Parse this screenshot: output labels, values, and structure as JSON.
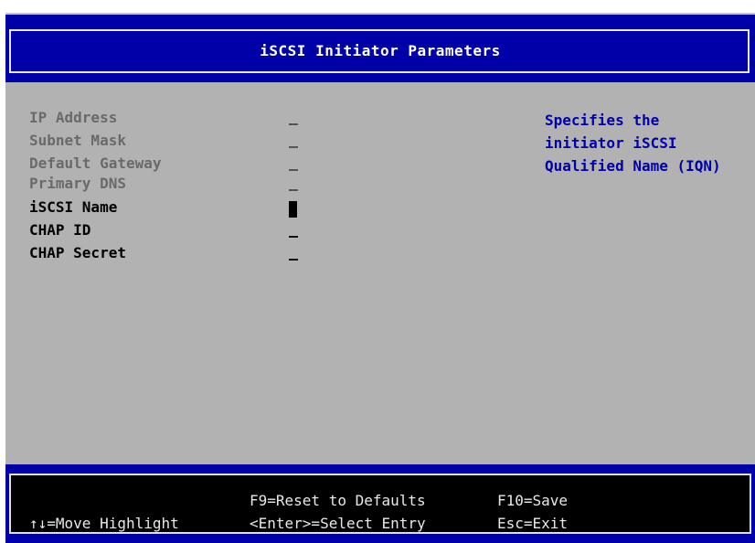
{
  "title": "iSCSI Initiator Parameters",
  "fields": [
    {
      "label": "IP Address",
      "value": "_",
      "enabled": false
    },
    {
      "label": "Subnet Mask",
      "value": "_",
      "enabled": false
    },
    {
      "label": "Default Gateway",
      "value": "_",
      "enabled": false
    },
    {
      "label": "Primary DNS",
      "value": "_",
      "enabled": false
    },
    {
      "label": "iSCSI Name",
      "value": "",
      "enabled": true,
      "selected": true
    },
    {
      "label": "CHAP ID",
      "value": "_",
      "enabled": true
    },
    {
      "label": "CHAP Secret",
      "value": "_",
      "enabled": true
    }
  ],
  "help": {
    "line1": "Specifies the",
    "line2": "initiator iSCSI",
    "line3": "Qualified Name (IQN)"
  },
  "footer": {
    "move": "↑↓=Move Highlight",
    "reset": "F9=Reset to Defaults",
    "select": "<Enter>=Select Entry",
    "save": "F10=Save",
    "exit": "Esc=Exit"
  },
  "colors": {
    "header_bg": "#0000a8",
    "panel_bg": "#b2b2b2",
    "footer_bg": "#000000",
    "help_text": "#0000a8"
  }
}
